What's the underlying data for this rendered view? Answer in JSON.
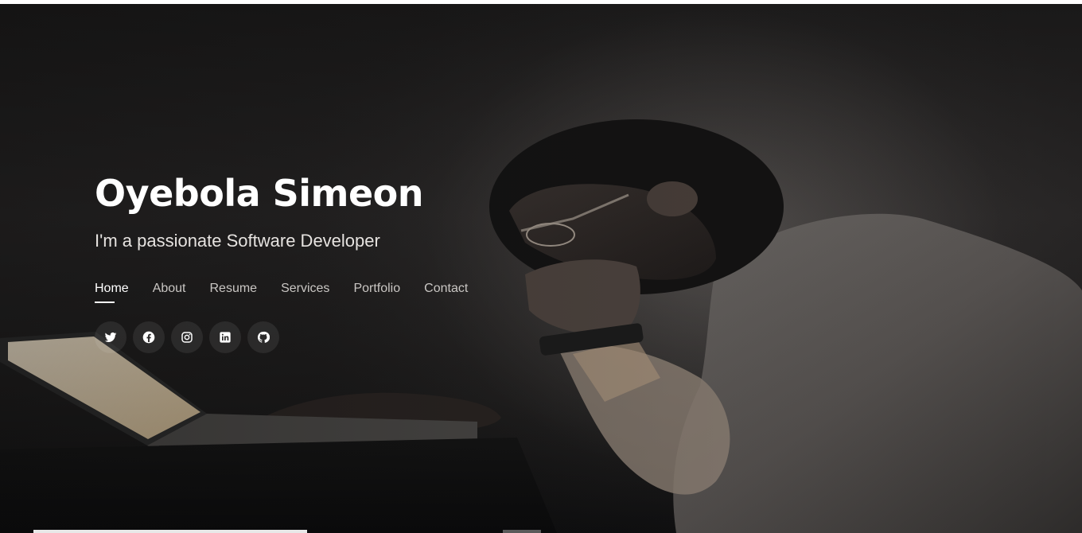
{
  "hero": {
    "name": "Oyebola Simeon",
    "tagline": "I'm a passionate Software Developer",
    "background_photo_icon": "man-with-laptop-photo"
  },
  "nav": {
    "items": [
      {
        "label": "Home",
        "active": true
      },
      {
        "label": "About",
        "active": false
      },
      {
        "label": "Resume",
        "active": false
      },
      {
        "label": "Services",
        "active": false
      },
      {
        "label": "Portfolio",
        "active": false
      },
      {
        "label": "Contact",
        "active": false
      }
    ]
  },
  "social": [
    {
      "icon": "twitter-icon"
    },
    {
      "icon": "facebook-icon"
    },
    {
      "icon": "instagram-icon"
    },
    {
      "icon": "linkedin-icon"
    },
    {
      "icon": "github-icon"
    }
  ],
  "colors": {
    "background": "#1e1d1d",
    "text_primary": "#ffffff",
    "text_secondary": "#c9c6c3"
  }
}
